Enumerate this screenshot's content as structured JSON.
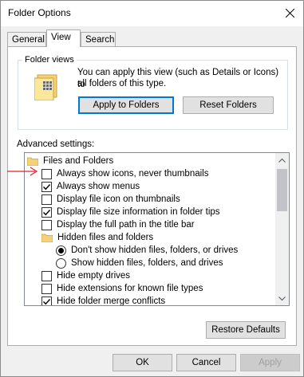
{
  "window": {
    "title": "Folder Options"
  },
  "tabs": [
    {
      "label": "General",
      "active": false
    },
    {
      "label": "View",
      "active": true
    },
    {
      "label": "Search",
      "active": false
    }
  ],
  "folder_views": {
    "legend": "Folder views",
    "line1": "You can apply this view (such as Details or Icons) to",
    "line2": "all folders of this type.",
    "apply_label": "Apply to Folders",
    "reset_label": "Reset Folders"
  },
  "advanced": {
    "label": "Advanced settings:",
    "items": [
      {
        "type": "folder",
        "label": "Files and Folders",
        "level": 0
      },
      {
        "type": "checkbox",
        "label": "Always show icons, never thumbnails",
        "checked": false,
        "level": 1
      },
      {
        "type": "checkbox",
        "label": "Always show menus",
        "checked": true,
        "level": 1
      },
      {
        "type": "checkbox",
        "label": "Display file icon on thumbnails",
        "checked": false,
        "level": 1
      },
      {
        "type": "checkbox",
        "label": "Display file size information in folder tips",
        "checked": true,
        "level": 1
      },
      {
        "type": "checkbox",
        "label": "Display the full path in the title bar",
        "checked": false,
        "level": 1
      },
      {
        "type": "folder",
        "label": "Hidden files and folders",
        "level": 1
      },
      {
        "type": "radio",
        "label": "Don't show hidden files, folders, or drives",
        "checked": true,
        "level": 2
      },
      {
        "type": "radio",
        "label": "Show hidden files, folders, and drives",
        "checked": false,
        "level": 2
      },
      {
        "type": "checkbox",
        "label": "Hide empty drives",
        "checked": false,
        "level": 1
      },
      {
        "type": "checkbox",
        "label": "Hide extensions for known file types",
        "checked": false,
        "level": 1
      },
      {
        "type": "checkbox",
        "label": "Hide folder merge conflicts",
        "checked": true,
        "level": 1
      }
    ]
  },
  "restore_label": "Restore Defaults",
  "footer": {
    "ok": "OK",
    "cancel": "Cancel",
    "apply": "Apply"
  },
  "colors": {
    "focus_accent": "#0078d7",
    "annotation_red": "#e0202a",
    "folder_yellow": "#f3d27a"
  }
}
